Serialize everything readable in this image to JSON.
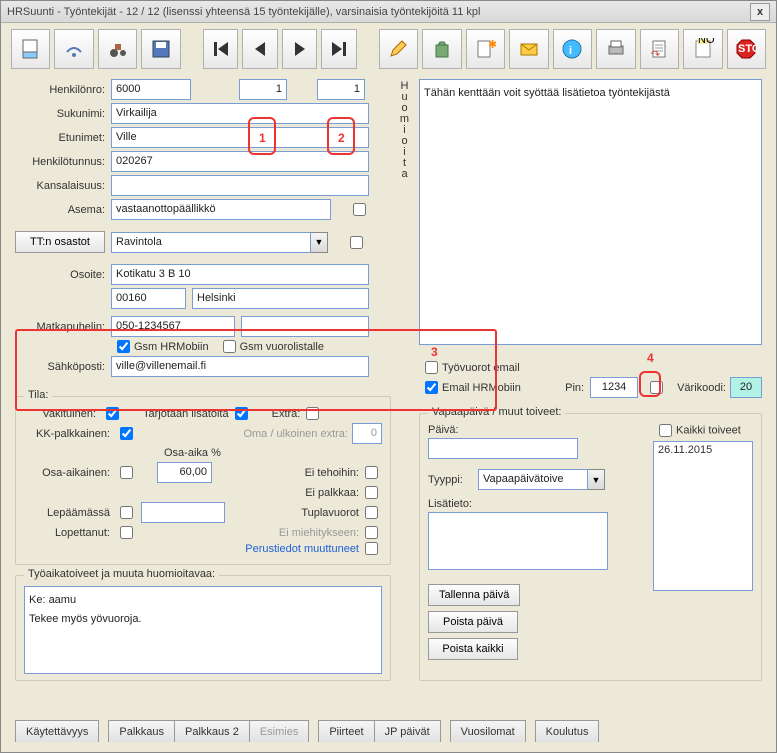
{
  "title": "HRSuunti - Työntekijät  - 12 / 12 (lisenssi yhteensä  15  työntekijälle), varsinaisia työntekijöitä 11 kpl",
  "close": "x",
  "fields": {
    "henkilonro_lbl": "Henkilönro:",
    "henkilonro": "6000",
    "num1": "1",
    "num2": "1",
    "sukunimi_lbl": "Sukunimi:",
    "sukunimi": "Virkailija",
    "etunimet_lbl": "Etunimet:",
    "etunimet": "Ville",
    "hetu_lbl": "Henkilötunnus:",
    "hetu": "020267",
    "kansalaisuus_lbl": "Kansalaisuus:",
    "kansalaisuus": "",
    "asema_lbl": "Asema:",
    "asema": "vastaanottopäällikkö",
    "osastot_lbl": "TT:n osastot",
    "osastot": "Ravintola",
    "osoite_lbl": "Osoite:",
    "osoite": "Kotikatu 3 B 10",
    "postinro": "00160",
    "kaupunki": "Helsinki",
    "matkapuhelin_lbl": "Matkapuhelin:",
    "matkapuhelin": "050-1234567",
    "gsm_hrmobiin": "Gsm HRMobiin",
    "gsm_vuorolistalle": "Gsm vuorolistalle",
    "sahkoposti_lbl": "Sähköposti:",
    "sahkoposti": "ville@villenemail.fi",
    "tyovuorot_email": "Työvuorot email",
    "email_hrmobiin": "Email HRMobiin",
    "huom_label": "Huomioita",
    "huom_text": "Tähän kenttään voit syöttää lisätietoa työntekijästä",
    "pin_lbl": "Pin:",
    "pin": "1234",
    "varikoodi_lbl": "Värikoodi:",
    "varikoodi": "20"
  },
  "tila": {
    "legend": "Tila:",
    "vakituinen": "Vakituinen:",
    "tarjotaan": "Tarjotaan lisätöitä",
    "extra": "Extra:",
    "kk": "KK-palkkainen:",
    "oma": "Oma / ulkoinen extra:",
    "oma_v": "0",
    "osa_aika_hdr": "Osa-aika %",
    "osa_aika_lbl": "Osa-aikainen:",
    "osa_aika_v": "60,00",
    "ei_tehoihin": "Ei tehoihin:",
    "ei_palkkaa": "Ei palkkaa:",
    "lepaa": "Lepäämässä",
    "tuplavuorot": "Tuplavuorot",
    "lopettanut": "Lopettanut:",
    "ei_miehitykseen": "Ei miehitykseen:",
    "perustiedot": "Perustiedot muuttuneet"
  },
  "notes": {
    "legend": "Työaikatoiveet ja muuta huomioitavaa:",
    "text": "Ke: aamu\nTekee myös yövuoroja."
  },
  "vapaa": {
    "legend": "Vapaapäivä / muut toiveet:",
    "paiva_lbl": "Päivä:",
    "tyyppi_lbl": "Tyyppi:",
    "tyyppi": "Vapaapäivätoive",
    "lisatieto_lbl": "Lisätieto:",
    "kaikki": "Kaikki toiveet",
    "date": "26.11.2015",
    "tallenna": "Tallenna päivä",
    "poista": "Poista päivä",
    "poista_kaikki": "Poista kaikki"
  },
  "tabs": [
    "Käytettävyys",
    "Palkkaus",
    "Palkkaus 2",
    "Esimies",
    "Piirteet",
    "JP päivät",
    "Vuosilomat",
    "Koulutus"
  ],
  "marks": {
    "m1": "1",
    "m2": "2",
    "m3": "3",
    "m4": "4"
  }
}
